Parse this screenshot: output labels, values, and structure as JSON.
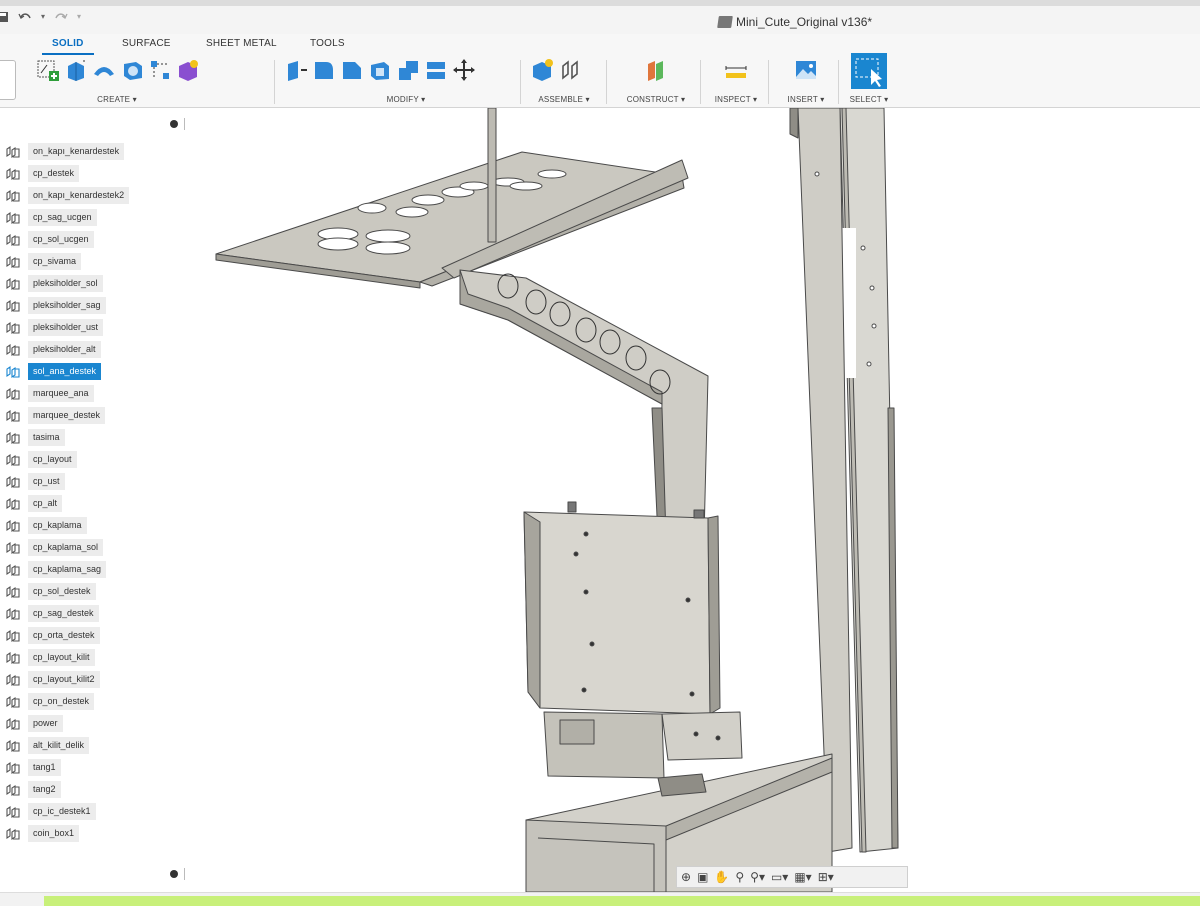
{
  "window": {
    "title": "Mini_Cute_Original v136*"
  },
  "tabs": [
    "SOLID",
    "SURFACE",
    "SHEET METAL",
    "TOOLS"
  ],
  "toolbar_groups": {
    "create": "CREATE ▾",
    "modify": "MODIFY ▾",
    "assemble": "ASSEMBLE ▾",
    "construct": "CONSTRUCT ▾",
    "inspect": "INSPECT ▾",
    "insert": "INSERT ▾",
    "select": "SELECT ▾"
  },
  "browser": {
    "selected_index": 10,
    "items": [
      "on_kapı_kenardestek",
      "cp_destek",
      "on_kapı_kenardestek2",
      "cp_sag_ucgen",
      "cp_sol_ucgen",
      "cp_sivama",
      "pleksiholder_sol",
      "pleksiholder_sag",
      "pleksiholder_ust",
      "pleksiholder_alt",
      "sol_ana_destek",
      "marquee_ana",
      "marquee_destek",
      "tasima",
      "cp_layout",
      "cp_ust",
      "cp_alt",
      "cp_kaplama",
      "cp_kaplama_sol",
      "cp_kaplama_sag",
      "cp_sol_destek",
      "cp_sag_destek",
      "cp_orta_destek",
      "cp_layout_kilit",
      "cp_layout_kilit2",
      "cp_on_destek",
      "power",
      "alt_kilit_delik",
      "tang1",
      "tang2",
      "cp_ic_destek1",
      "coin_box1"
    ]
  },
  "colors": {
    "accent": "#0a6fc2",
    "selection": "#1a86d0",
    "model_fill": "#d5d3cc",
    "model_edge": "#4a4a4a",
    "status_green": "#c8f07a"
  },
  "icons": {
    "quick_access": [
      "save-icon",
      "undo-icon",
      "redo-icon"
    ],
    "nav_bar": [
      "orbit-icon",
      "look-at-icon",
      "pan-icon",
      "zoom-icon",
      "zoom-window-icon",
      "display-mode-icon",
      "grid-icon",
      "viewports-icon"
    ]
  }
}
